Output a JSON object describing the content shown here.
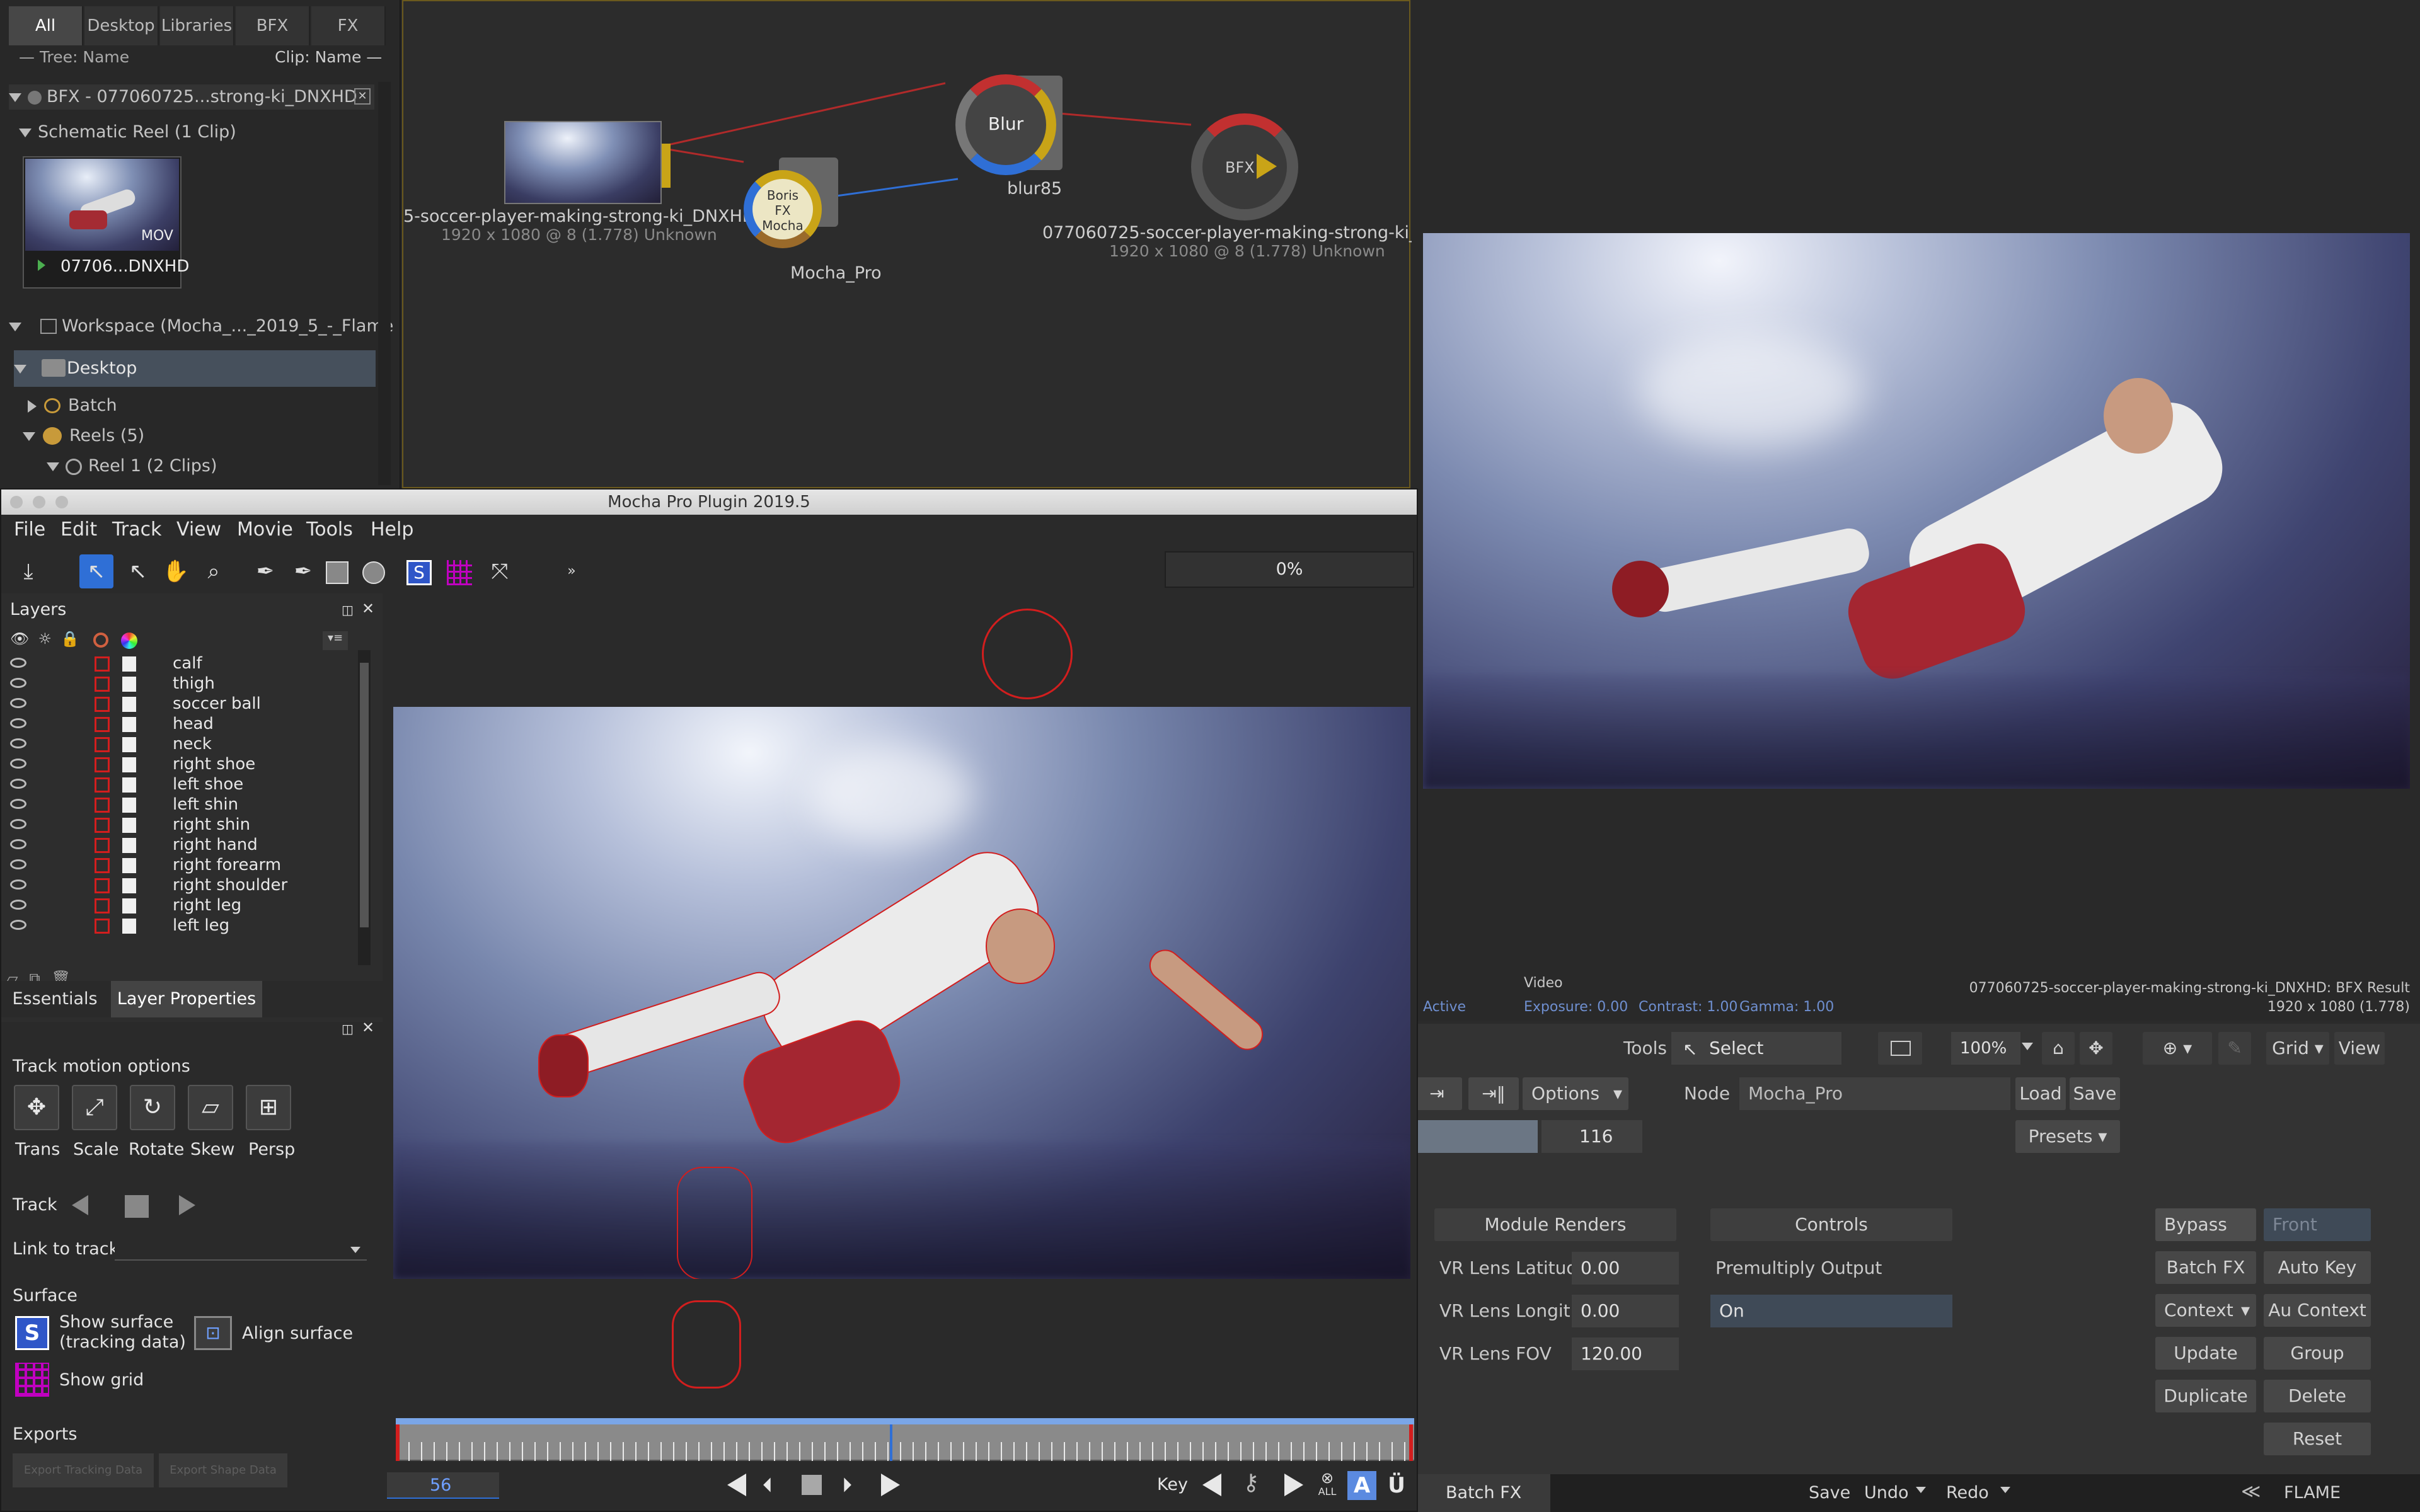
{
  "library": {
    "tabs": [
      "All",
      "Desktop",
      "Libraries",
      "BFX",
      "FX"
    ],
    "tree_header": "— Tree: Name",
    "clip_header": "Clip: Name —",
    "bfx_item": "BFX - 077060725...strong-ki_DNXHD",
    "schematic_reel": "Schematic Reel (1 Clip)",
    "clip_badge": "MOV",
    "clip_name": "07706...DNXHD",
    "workspace": "Workspace (Mocha_..._2019_5_-_Flame",
    "desktop": "Desktop",
    "batch": "Batch",
    "reels": "Reels (5)",
    "reel1": "Reel 1 (2 Clips)"
  },
  "graph": {
    "source_name": "5-soccer-player-making-strong-ki_DNXHD [",
    "source_res": "1920 x 1080 @ 8 (1.778)  Unknown",
    "mocha_node_lines": [
      "Boris",
      "FX",
      "Mocha"
    ],
    "mocha_node_label": "Mocha_Pro",
    "blur_node_text": "Blur",
    "blur_node_label": "blur85",
    "output_node_text": "BFX",
    "output_name": "077060725-soccer-player-making-strong-ki_DN",
    "output_res": "1920 x 1080 @ 8 (1.778)  Unknown"
  },
  "viewer": {
    "status_active": "Active",
    "video_label": "Video",
    "exposure": "Exposure: 0.00",
    "contrast": "Contrast: 1.00",
    "gamma": "Gamma: 1.00",
    "clip_result": "077060725-soccer-player-making-strong-ki_DNXHD: BFX Result",
    "clip_res": "1920 x 1080 (1.778)"
  },
  "batch": {
    "tools_label": "Tools",
    "select_label": "Select",
    "zoom": "100%",
    "grid_label": "Grid",
    "view_label": "View",
    "options_label": "Options",
    "node_label": "Node",
    "node_value": "Mocha_Pro",
    "load": "Load",
    "save": "Save",
    "presets": "Presets",
    "frame_value": "116",
    "module_renders": "Module Renders",
    "controls": "Controls",
    "vr_latitude_label": "VR Lens Latitude",
    "vr_latitude_value": "0.00",
    "vr_longitude_label": "VR Lens Longitud",
    "vr_longitude_value": "0.00",
    "vr_fov_label": "VR Lens FOV",
    "vr_fov_value": "120.00",
    "premult_label": "Premultiply Output",
    "premult_value": "On",
    "bypass": "Bypass",
    "front": "Front",
    "batch_fx": "Batch FX",
    "auto_key": "Auto Key",
    "context": "Context",
    "au_context": "Au Context",
    "update": "Update",
    "group": "Group",
    "duplicate": "Duplicate",
    "delete": "Delete",
    "reset": "Reset",
    "tab_batch_fx": "Batch FX",
    "save_bottom": "Save",
    "undo": "Undo",
    "redo": "Redo",
    "brand": "FLAME"
  },
  "mocha": {
    "title": "Mocha Pro Plugin 2019.5",
    "menu": [
      "File",
      "Edit",
      "Track",
      "View",
      "Movie",
      "Tools",
      "Help"
    ],
    "progress": "0%",
    "layers_title": "Layers",
    "layers": [
      "calf",
      "thigh",
      "soccer ball",
      "head",
      "neck",
      "right shoe",
      "left shoe",
      "left shin",
      "right shin",
      "right hand",
      "right forearm",
      "right shoulder",
      "right leg",
      "left leg"
    ],
    "tab_essentials": "Essentials",
    "tab_layer_props": "Layer Properties",
    "track_motion_title": "Track motion options",
    "motion_options": [
      "Trans",
      "Scale",
      "Rotate",
      "Skew",
      "Persp"
    ],
    "track_label": "Track",
    "link_to_track": "Link to track",
    "surface_title": "Surface",
    "show_surface_l1": "Show surface",
    "show_surface_l2": "(tracking data)",
    "align_surface": "Align surface",
    "show_grid": "Show grid",
    "exports_title": "Exports",
    "export_tracking": "Export Tracking Data",
    "export_shape": "Export Shape Data",
    "current_frame": "56",
    "key_label": "Key",
    "all_label": "ALL"
  },
  "colors": {
    "accent_blue": "#2f6fd6",
    "shape_red": "#d21e1e",
    "grid_magenta": "#c000c0"
  }
}
